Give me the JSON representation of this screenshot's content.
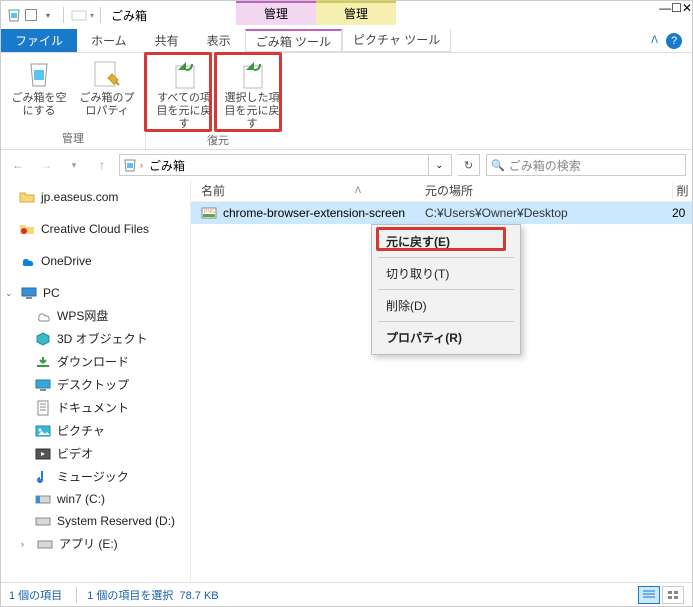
{
  "title": "ごみ箱",
  "contextual_tabs": {
    "left": "管理",
    "right": "管理"
  },
  "menu": {
    "file": "ファイル",
    "home": "ホーム",
    "share": "共有",
    "view": "表示",
    "tool1": "ごみ箱 ツール",
    "tool2": "ピクチャ ツール"
  },
  "ribbon": {
    "group1_label": "管理",
    "empty": "ごみ箱を空にする",
    "props": "ごみ箱のプロパティ",
    "group2_label": "復元",
    "restore_all": "すべての項目を元に戻す",
    "restore_sel": "選択した項目を元に戻す"
  },
  "nav": {
    "path_seg": "ごみ箱",
    "search_placeholder": "ごみ箱の検索"
  },
  "tree": {
    "easeus": "jp.easeus.com",
    "ccf": "Creative Cloud Files",
    "onedrive": "OneDrive",
    "pc": "PC",
    "wps": "WPS网盘",
    "obj3d": "3D オブジェクト",
    "downloads": "ダウンロード",
    "desktop": "デスクトップ",
    "documents": "ドキュメント",
    "pictures": "ピクチャ",
    "videos": "ビデオ",
    "music": "ミュージック",
    "win7": "win7 (C:)",
    "sysres": "System Reserved (D:)",
    "apps": "アプリ (E:)"
  },
  "cols": {
    "name": "名前",
    "loc": "元の場所",
    "right": "削"
  },
  "file": {
    "name": "chrome-browser-extension-screen",
    "loc": "C:¥Users¥Owner¥Desktop",
    "right": "20"
  },
  "ctx": {
    "restore": "元に戻す(E)",
    "cut": "切り取り(T)",
    "delete": "削除(D)",
    "props": "プロパティ(R)"
  },
  "status": {
    "count": "1 個の項目",
    "sel": "1 個の項目を選択",
    "size": "78.7 KB"
  }
}
